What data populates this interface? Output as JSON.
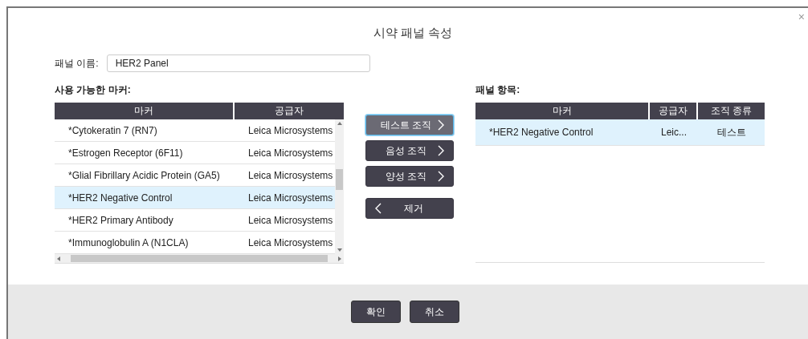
{
  "dialog": {
    "title": "시약 패널 속성",
    "close": "×"
  },
  "panel_name": {
    "label": "패널 이름:",
    "value": "HER2 Panel"
  },
  "available": {
    "heading": "사용 가능한 마커:",
    "columns": [
      "마커",
      "공급자"
    ],
    "rows": [
      {
        "marker": "*Cytokeratin 7 (RN7)",
        "supplier": "Leica Microsystems",
        "selected": false
      },
      {
        "marker": "*Estrogen Receptor (6F11)",
        "supplier": "Leica Microsystems",
        "selected": false
      },
      {
        "marker": "*Glial Fibrillary Acidic Protein (GA5)",
        "supplier": "Leica Microsystems",
        "selected": false
      },
      {
        "marker": "*HER2 Negative Control",
        "supplier": "Leica Microsystems",
        "selected": true
      },
      {
        "marker": "*HER2 Primary Antibody",
        "supplier": "Leica Microsystems",
        "selected": false
      },
      {
        "marker": "*Immunoglobulin A (N1CLA)",
        "supplier": "Leica Microsystems",
        "selected": false
      }
    ]
  },
  "actions": [
    {
      "label": "테스트 조직",
      "kind": "add",
      "focused": true
    },
    {
      "label": "음성 조직",
      "kind": "add",
      "focused": false
    },
    {
      "label": "양성 조직",
      "kind": "add",
      "focused": false
    },
    {
      "label": "제거",
      "kind": "remove",
      "focused": false
    }
  ],
  "panel_items": {
    "heading": "패널 항목:",
    "columns": [
      "마커",
      "공급자",
      "조직 종류"
    ],
    "rows": [
      {
        "marker": "*HER2 Negative Control",
        "supplier": "Leic...",
        "tissue_type": "테스트",
        "selected": true
      }
    ]
  },
  "footer_buttons": [
    "확인",
    "취소"
  ]
}
